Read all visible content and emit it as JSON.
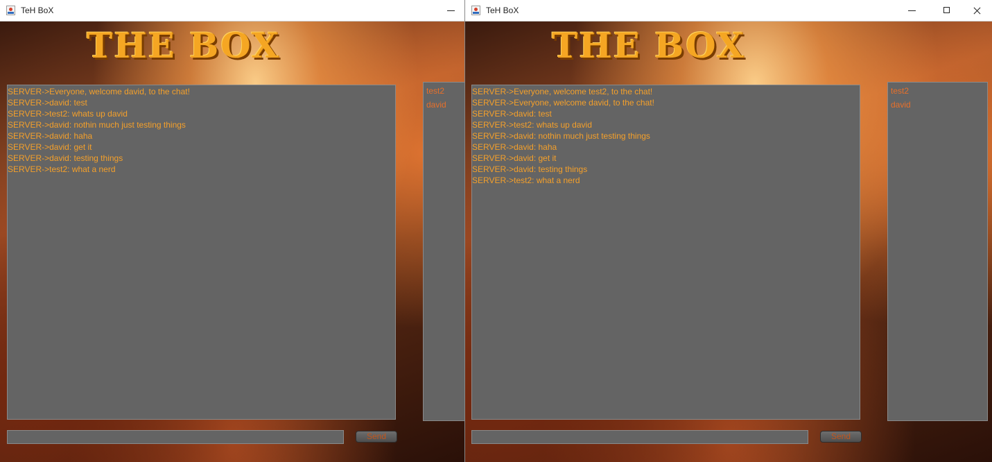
{
  "windows": [
    {
      "title": "TeH BoX",
      "logo_text": "THE BOX",
      "messages": [
        "SERVER->Everyone, welcome david, to the chat!",
        "SERVER->david: test",
        "SERVER->test2: whats up david",
        "SERVER->david: nothin much just testing things",
        "SERVER->david: haha",
        "SERVER->david: get it",
        "SERVER->david: testing things",
        "SERVER->test2: what a nerd"
      ],
      "users": [
        "test2",
        "david"
      ],
      "input_value": "",
      "send_label": "Send"
    },
    {
      "title": "TeH BoX",
      "logo_text": "THE BOX",
      "messages": [
        "SERVER->Everyone, welcome test2, to the chat!",
        "SERVER->Everyone, welcome david, to the chat!",
        "SERVER->david: test",
        "SERVER->test2: whats up david",
        "SERVER->david: nothin much just testing things",
        "SERVER->david: haha",
        "SERVER->david: get it",
        "SERVER->david: testing things",
        "SERVER->test2: what a nerd"
      ],
      "users": [
        "test2",
        "david"
      ],
      "input_value": "",
      "send_label": "Send"
    }
  ],
  "colors": {
    "panel": "#646464",
    "message_text": "#f5a02a",
    "user_text": "#e8702a",
    "logo": "#f5a623"
  },
  "icons": {
    "app": "java-app-icon",
    "minimize": "minimize-icon",
    "maximize": "maximize-icon",
    "close": "close-icon"
  }
}
